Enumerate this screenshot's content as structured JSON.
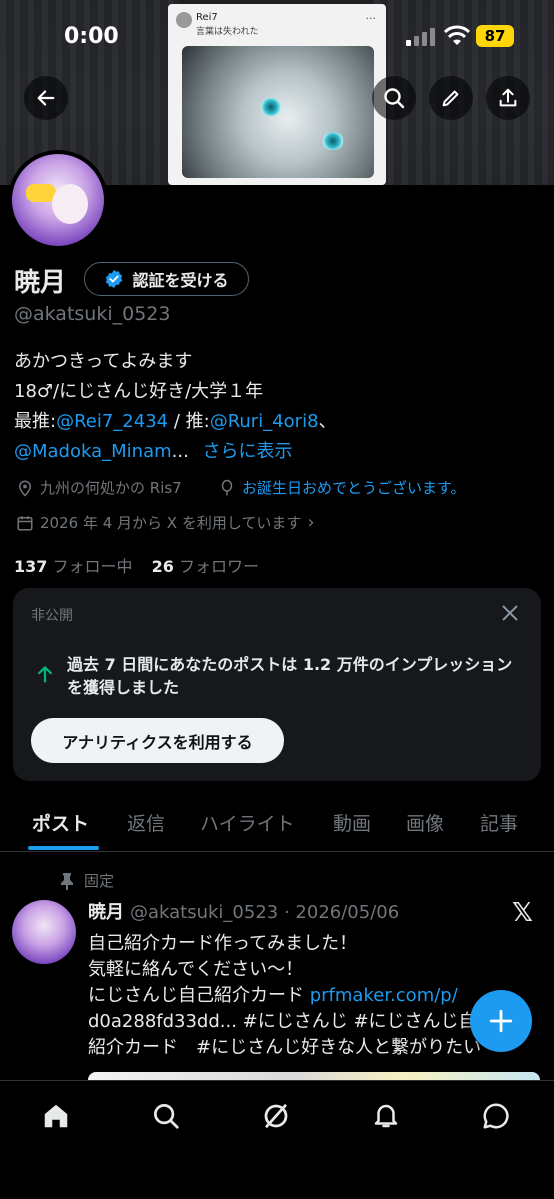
{
  "status_bar": {
    "time": "0:00",
    "battery": "87"
  },
  "banner": {
    "card_title": "Rei7",
    "card_subtitle": "言葉は失われた"
  },
  "profile": {
    "name": "暁月",
    "verify_label": "認証を受ける",
    "handle": "@akatsuki_0523",
    "bio": {
      "line1": "あかつきってよみます",
      "line2": "18♂/にじさんじ好き/大学１年",
      "line3_prefix": "最推:",
      "line3_mention1": "@Rei7_2434",
      "line3_mid": " / 推:",
      "line3_mention2": "@Ruri_4ori8",
      "line3_suffix": "、",
      "line4_mention": "@Madoka_Minam",
      "line4_ellipsis": "...",
      "show_more": "さらに表示"
    },
    "location": "九州の何処かの Ris7",
    "birthday": "お誕生日おめでとうございます。",
    "joined": "2026 年 4 月から X を利用しています",
    "following_count": "137",
    "following_label": "フォロー中",
    "followers_count": "26",
    "followers_label": "フォロワー"
  },
  "private_card": {
    "label": "非公開",
    "message": "過去 7 日間にあなたのポストは 1.2 万件のインプレッションを獲得しました",
    "button": "アナリティクスを利用する"
  },
  "tabs": [
    "ポスト",
    "返信",
    "ハイライト",
    "動画",
    "画像",
    "記事"
  ],
  "post": {
    "pinned_label": "固定",
    "name": "暁月",
    "meta": "@akatsuki_0523 · 2026/05/06",
    "line1": "自己紹介カード作ってみました！",
    "line2": "気軽に絡んでください〜！",
    "line3_text": "にじさんじ自己紹介カード ",
    "line3_link": "prfmaker.com/p/",
    "line4": "d0a288fd33dd... #にじさんじ  #にじさんじ自己",
    "line5": "紹介カード　#にじさんじ好きな人と繋がりたい"
  },
  "colors": {
    "accent": "#1d9bf0",
    "background": "#000000",
    "card": "#16181c",
    "battery": "#ffd60a",
    "success": "#00ba7c"
  },
  "icons": {
    "back": "back-arrow-icon",
    "search": "search-icon",
    "edit": "edit-icon",
    "share": "share-icon",
    "verified": "verified-badge-icon",
    "location": "location-icon",
    "balloon": "balloon-icon",
    "calendar": "calendar-icon",
    "pin": "pin-icon",
    "close": "close-icon",
    "trend": "trend-up-icon",
    "compose": "plus-icon",
    "home": "home-icon",
    "grok": "grok-icon",
    "bell": "bell-icon",
    "messages": "messages-icon"
  }
}
